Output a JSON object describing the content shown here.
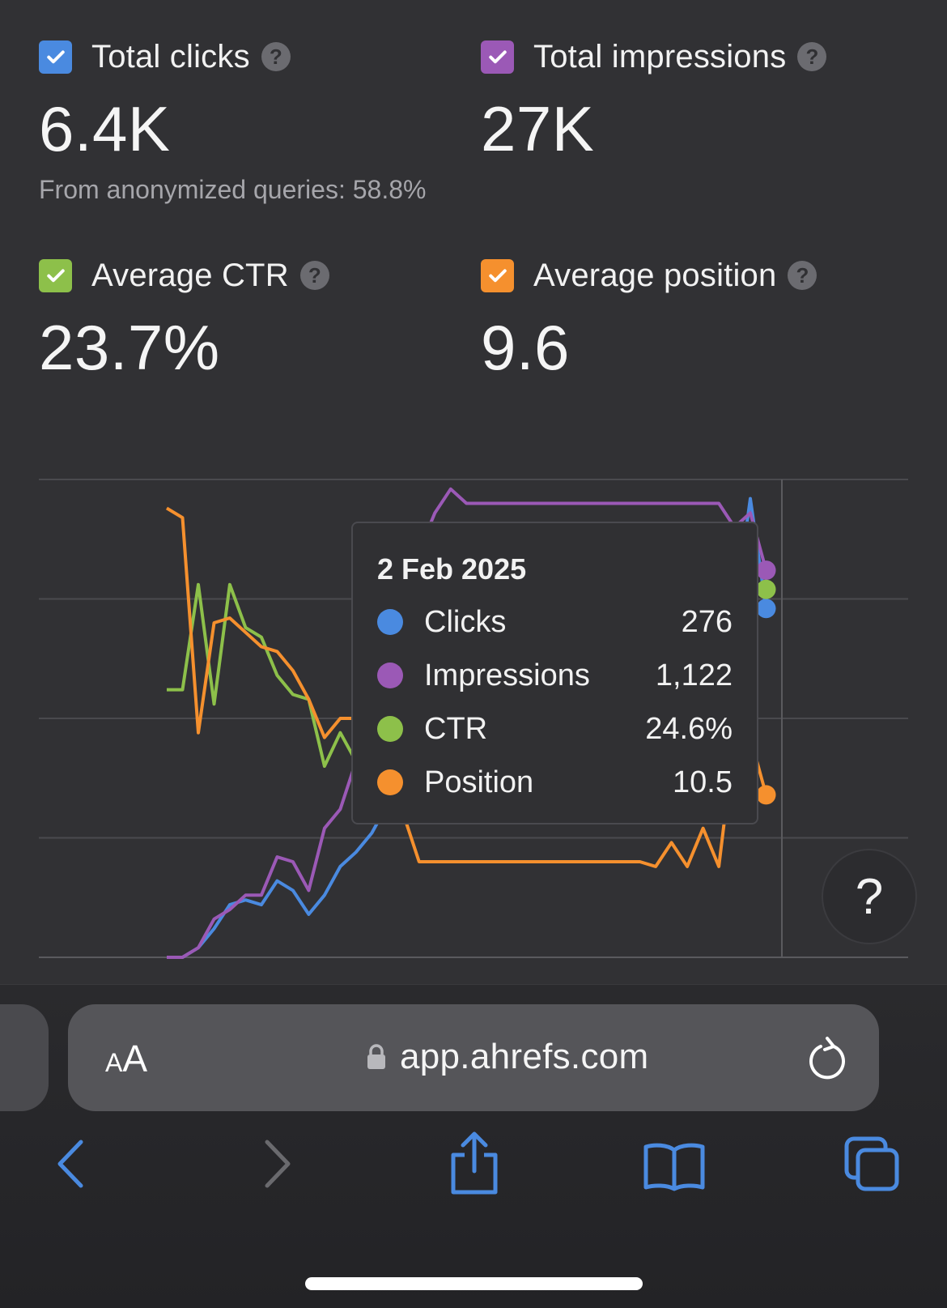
{
  "metrics": {
    "clicks": {
      "label": "Total clicks",
      "value": "6.4K",
      "color": "#4a8ae0",
      "checked": true
    },
    "impressions": {
      "label": "Total impressions",
      "value": "27K",
      "color": "#9b59b6",
      "checked": true
    },
    "ctr": {
      "label": "Average CTR",
      "value": "23.7%",
      "color": "#8dc04a",
      "checked": true
    },
    "position": {
      "label": "Average position",
      "value": "9.6",
      "color": "#f5902e",
      "checked": true
    },
    "note": "From anonymized queries: 58.8%"
  },
  "tooltip": {
    "date": "2 Feb 2025",
    "rows": [
      {
        "name": "Clicks",
        "value": "276",
        "color": "#4a8ae0"
      },
      {
        "name": "Impressions",
        "value": "1,122",
        "color": "#9b59b6"
      },
      {
        "name": "CTR",
        "value": "24.6%",
        "color": "#8dc04a"
      },
      {
        "name": "Position",
        "value": "10.5",
        "color": "#f5902e"
      }
    ]
  },
  "help_button": "?",
  "browser": {
    "aa_label_small": "A",
    "aa_label_large": "A",
    "url": "app.ahrefs.com"
  },
  "chart_data": {
    "type": "line",
    "title": "",
    "xlabel": "",
    "ylabel": "",
    "grid": true,
    "legend": "none",
    "note": "Values are normalized 0-1 (chart height, 1 = top gridline); series drawn with independent scales, no axis labels shown",
    "x": [
      0,
      1,
      2,
      3,
      4,
      5,
      6,
      7,
      8,
      9,
      10,
      11,
      12,
      13,
      14,
      15,
      16,
      17,
      18,
      19,
      20,
      21,
      22,
      23,
      24,
      25,
      26,
      27,
      28,
      29,
      30,
      31,
      32,
      33,
      34,
      35,
      36,
      37,
      38,
      39
    ],
    "series": [
      {
        "name": "Clicks",
        "color": "#4a8ae0",
        "values": [
          0.0,
          0.0,
          0.02,
          0.06,
          0.11,
          0.12,
          0.11,
          0.16,
          0.14,
          0.09,
          0.13,
          0.19,
          0.22,
          0.26,
          0.32,
          0.4,
          0.5,
          0.58,
          0.62,
          0.66,
          0.66,
          0.66,
          0.66,
          0.66,
          0.66,
          0.66,
          0.66,
          0.66,
          0.66,
          0.66,
          0.66,
          0.66,
          0.66,
          0.66,
          0.66,
          0.66,
          0.72,
          0.96,
          0.73
        ]
      },
      {
        "name": "Impressions",
        "color": "#9b59b6",
        "values": [
          0.0,
          0.0,
          0.02,
          0.08,
          0.1,
          0.13,
          0.13,
          0.21,
          0.2,
          0.14,
          0.27,
          0.31,
          0.41,
          0.52,
          0.56,
          0.72,
          0.85,
          0.93,
          0.98,
          0.95,
          0.95,
          0.95,
          0.95,
          0.95,
          0.95,
          0.95,
          0.95,
          0.95,
          0.95,
          0.95,
          0.95,
          0.95,
          0.95,
          0.95,
          0.95,
          0.95,
          0.9,
          0.93,
          0.81
        ]
      },
      {
        "name": "CTR",
        "color": "#8dc04a",
        "values": [
          0.56,
          0.56,
          0.78,
          0.53,
          0.78,
          0.69,
          0.67,
          0.59,
          0.55,
          0.54,
          0.4,
          0.47,
          0.41,
          0.37,
          0.37,
          0.37,
          0.37,
          0.37,
          0.37,
          0.37,
          0.37,
          0.37,
          0.37,
          0.37,
          0.37,
          0.37,
          0.37,
          0.37,
          0.37,
          0.37,
          0.37,
          0.37,
          0.37,
          0.37,
          0.37,
          0.37,
          0.77,
          0.79,
          0.77
        ]
      },
      {
        "name": "Position",
        "color": "#f5902e",
        "values": [
          0.94,
          0.92,
          0.47,
          0.7,
          0.71,
          0.68,
          0.65,
          0.64,
          0.6,
          0.54,
          0.46,
          0.5,
          0.5,
          0.5,
          0.3,
          0.3,
          0.2,
          0.2,
          0.2,
          0.2,
          0.2,
          0.2,
          0.2,
          0.2,
          0.2,
          0.2,
          0.2,
          0.2,
          0.2,
          0.2,
          0.2,
          0.19,
          0.24,
          0.19,
          0.27,
          0.19,
          0.46,
          0.46,
          0.34
        ]
      }
    ]
  }
}
